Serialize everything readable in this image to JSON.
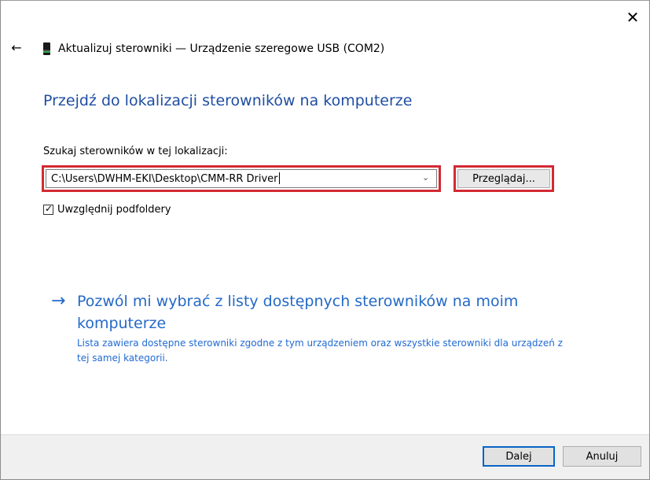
{
  "window": {
    "title": "Aktualizuj sterowniki — Urządzenie szeregowe USB (COM2)",
    "close_glyph": "✕",
    "back_glyph": "←"
  },
  "main": {
    "heading": "Przejdź do lokalizacji sterowników na komputerze",
    "search_label": "Szukaj sterowników w tej lokalizacji:",
    "path_value": "C:\\Users\\DWHM-EKI\\Desktop\\CMM-RR Driver",
    "browse_label": "Przeglądaj...",
    "subfolders_label": "Uwzględnij podfoldery",
    "subfolders_checked": true,
    "pick_link_title": "Pozwól mi wybrać z listy dostępnych sterowników na moim komputerze",
    "pick_link_desc": "Lista zawiera dostępne sterowniki zgodne z tym urządzeniem oraz wszystkie sterowniki dla urządzeń z tej samej kategorii."
  },
  "footer": {
    "next_label": "Dalej",
    "cancel_label": "Anuluj"
  },
  "colors": {
    "heading_blue": "#1f4ea3",
    "link_blue": "#2469c7",
    "highlight_red": "#d32a33",
    "default_button_border": "#0a63c7"
  },
  "icons": {
    "back": "back-arrow-icon",
    "device": "usb-device-icon",
    "close": "close-icon",
    "dropdown": "chevron-down-icon",
    "check": "checkmark-icon",
    "link_arrow": "right-arrow-icon"
  }
}
